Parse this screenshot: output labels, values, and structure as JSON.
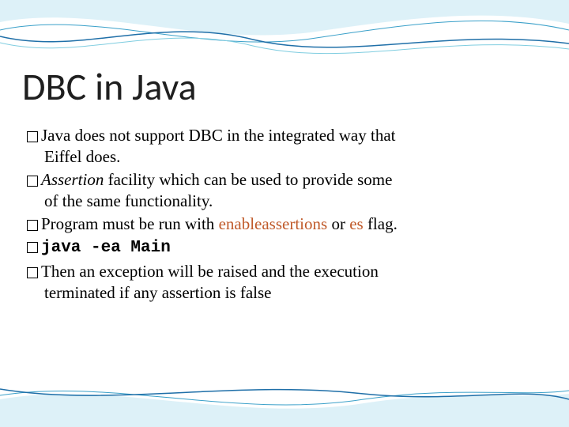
{
  "title": "DBC in Java",
  "bullets": {
    "b1a": "Java does not support DBC in the integrated way that",
    "b1b": "Eiffel does.",
    "b2a_i": "Assertion",
    "b2a_rest": " facility which can be used to provide some",
    "b2b": "of the same functionality.",
    "b3a": "Program must be run with ",
    "b3_enable": "enableassertions",
    "b3_or": " or ",
    "b3_es": "es",
    "b3_end": " flag.",
    "b4_code": "java -ea Main",
    "b5a": "Then an exception will be raised and the execution",
    "b5b": "terminated if any assertion is false"
  }
}
